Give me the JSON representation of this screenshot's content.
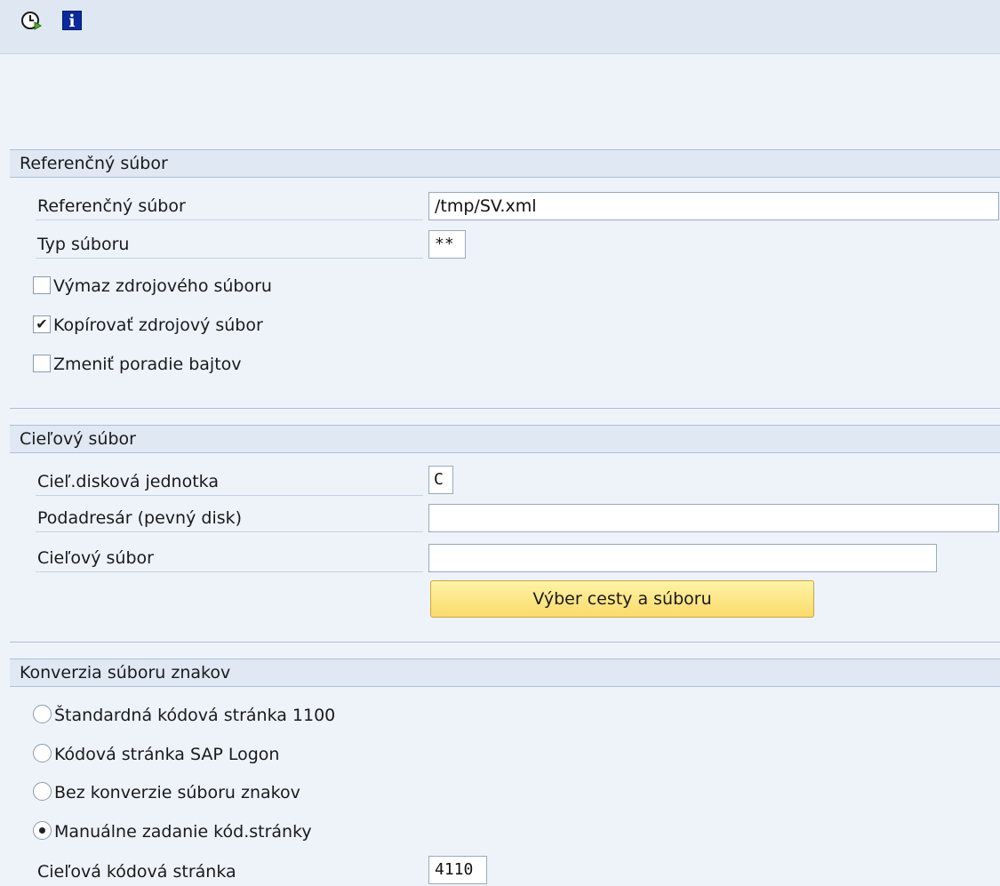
{
  "toolbar": {
    "execute_icon": "execute-clock-icon",
    "info_icon": "info-icon",
    "info_glyph": "i"
  },
  "reference_group": {
    "title": "Referenčný súbor",
    "reference_file_label": "Referenčný súbor",
    "reference_file_value": "/tmp/SV.xml",
    "file_type_label": "Typ súboru",
    "file_type_value": "**",
    "delete_source_label": "Výmaz zdrojového súboru",
    "delete_source_checked": false,
    "copy_source_label": "Kopírovať zdrojový súbor",
    "copy_source_checked": true,
    "change_byte_order_label": "Zmeniť poradie bajtov",
    "change_byte_order_checked": false
  },
  "target_group": {
    "title": "Cieľový súbor",
    "drive_label": "Cieľ.disková jednotka",
    "drive_value": "C",
    "subdir_label": "Podadresár (pevný disk)",
    "subdir_value": "",
    "target_file_label": "Cieľový súbor",
    "target_file_value": "",
    "select_path_button": "Výber cesty a súboru"
  },
  "conversion_group": {
    "title": "Konverzia súboru znakov",
    "options": [
      {
        "label": "Štandardná kódová stránka 1100",
        "selected": false
      },
      {
        "label": "Kódová stránka SAP Logon",
        "selected": false
      },
      {
        "label": "Bez konverzie súboru znakov",
        "selected": false
      },
      {
        "label": "Manuálne zadanie kód.stránky",
        "selected": true
      }
    ],
    "target_codepage_label": "Cieľová kódová stránka",
    "target_codepage_value": "4110"
  },
  "colors": {
    "background": "#eef3fa",
    "group_header": "#dfe8f3",
    "button_yellow": "#fbdb6b"
  }
}
